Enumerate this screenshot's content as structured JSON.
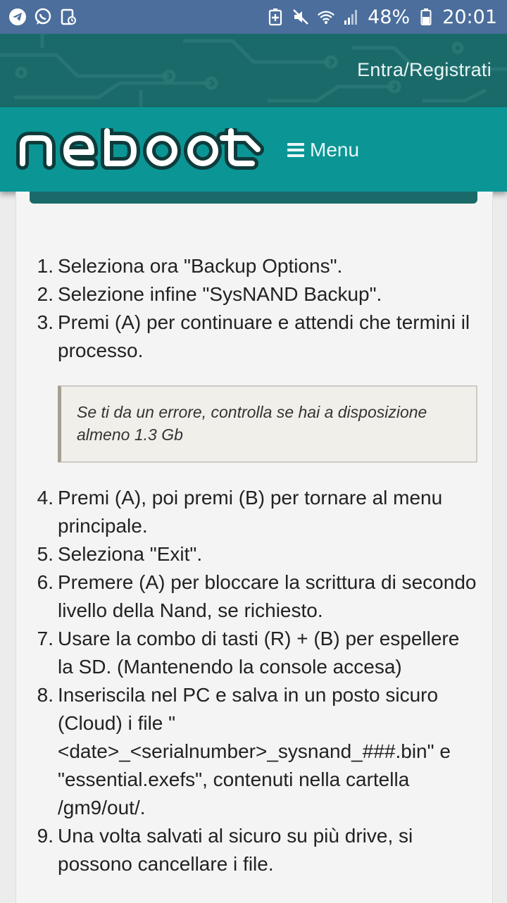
{
  "status_bar": {
    "battery": "48%",
    "time": "20:01",
    "left_icons": [
      "telegram-icon",
      "whatsapp-icon",
      "notification-icon"
    ],
    "right_icons": [
      "battery-saver-icon",
      "mute-icon",
      "wifi-icon",
      "signal-icon",
      "battery-icon"
    ]
  },
  "header": {
    "login_label": "Entra/Registrati",
    "logo_text": "reboot",
    "menu_label": "Menu"
  },
  "steps_part1": [
    {
      "num": "1.",
      "text": "Seleziona ora \"Backup Options\"."
    },
    {
      "num": "2.",
      "text": "Selezione infine \"SysNAND Backup\"."
    },
    {
      "num": "3.",
      "text": "Premi (A) per continuare e attendi che termini il processo."
    }
  ],
  "note": "Se ti da un errore, controlla se hai a disposizione almeno 1.3 Gb",
  "steps_part2": [
    {
      "num": "4.",
      "text": "Premi (A), poi premi (B) per tornare al menu principale."
    },
    {
      "num": "5.",
      "text": "Seleziona \"Exit\"."
    },
    {
      "num": "6.",
      "text": "Premere (A) per bloccare la scrittura di secondo livello della Nand, se richiesto."
    },
    {
      "num": "7.",
      "text": "Usare la combo di tasti (R) + (B) per espellere la SD. (Mantenendo la console accesa)"
    },
    {
      "num": "8.",
      "text": "Inseriscila nel PC e salva in un posto sicuro (Cloud) i file \"<date>_<serialnumber>_sysnand_###.bin\" e \"essential.exefs\", contenuti nella cartella /gm9/out/."
    },
    {
      "num": "9.",
      "text": "Una volta salvati al sicuro su più drive, si possono cancellare i file."
    }
  ],
  "colors": {
    "status_bar": "#4b6e9c",
    "header_dark": "#1b6a6a",
    "nav_teal": "#0b9595",
    "text": "#222222"
  }
}
